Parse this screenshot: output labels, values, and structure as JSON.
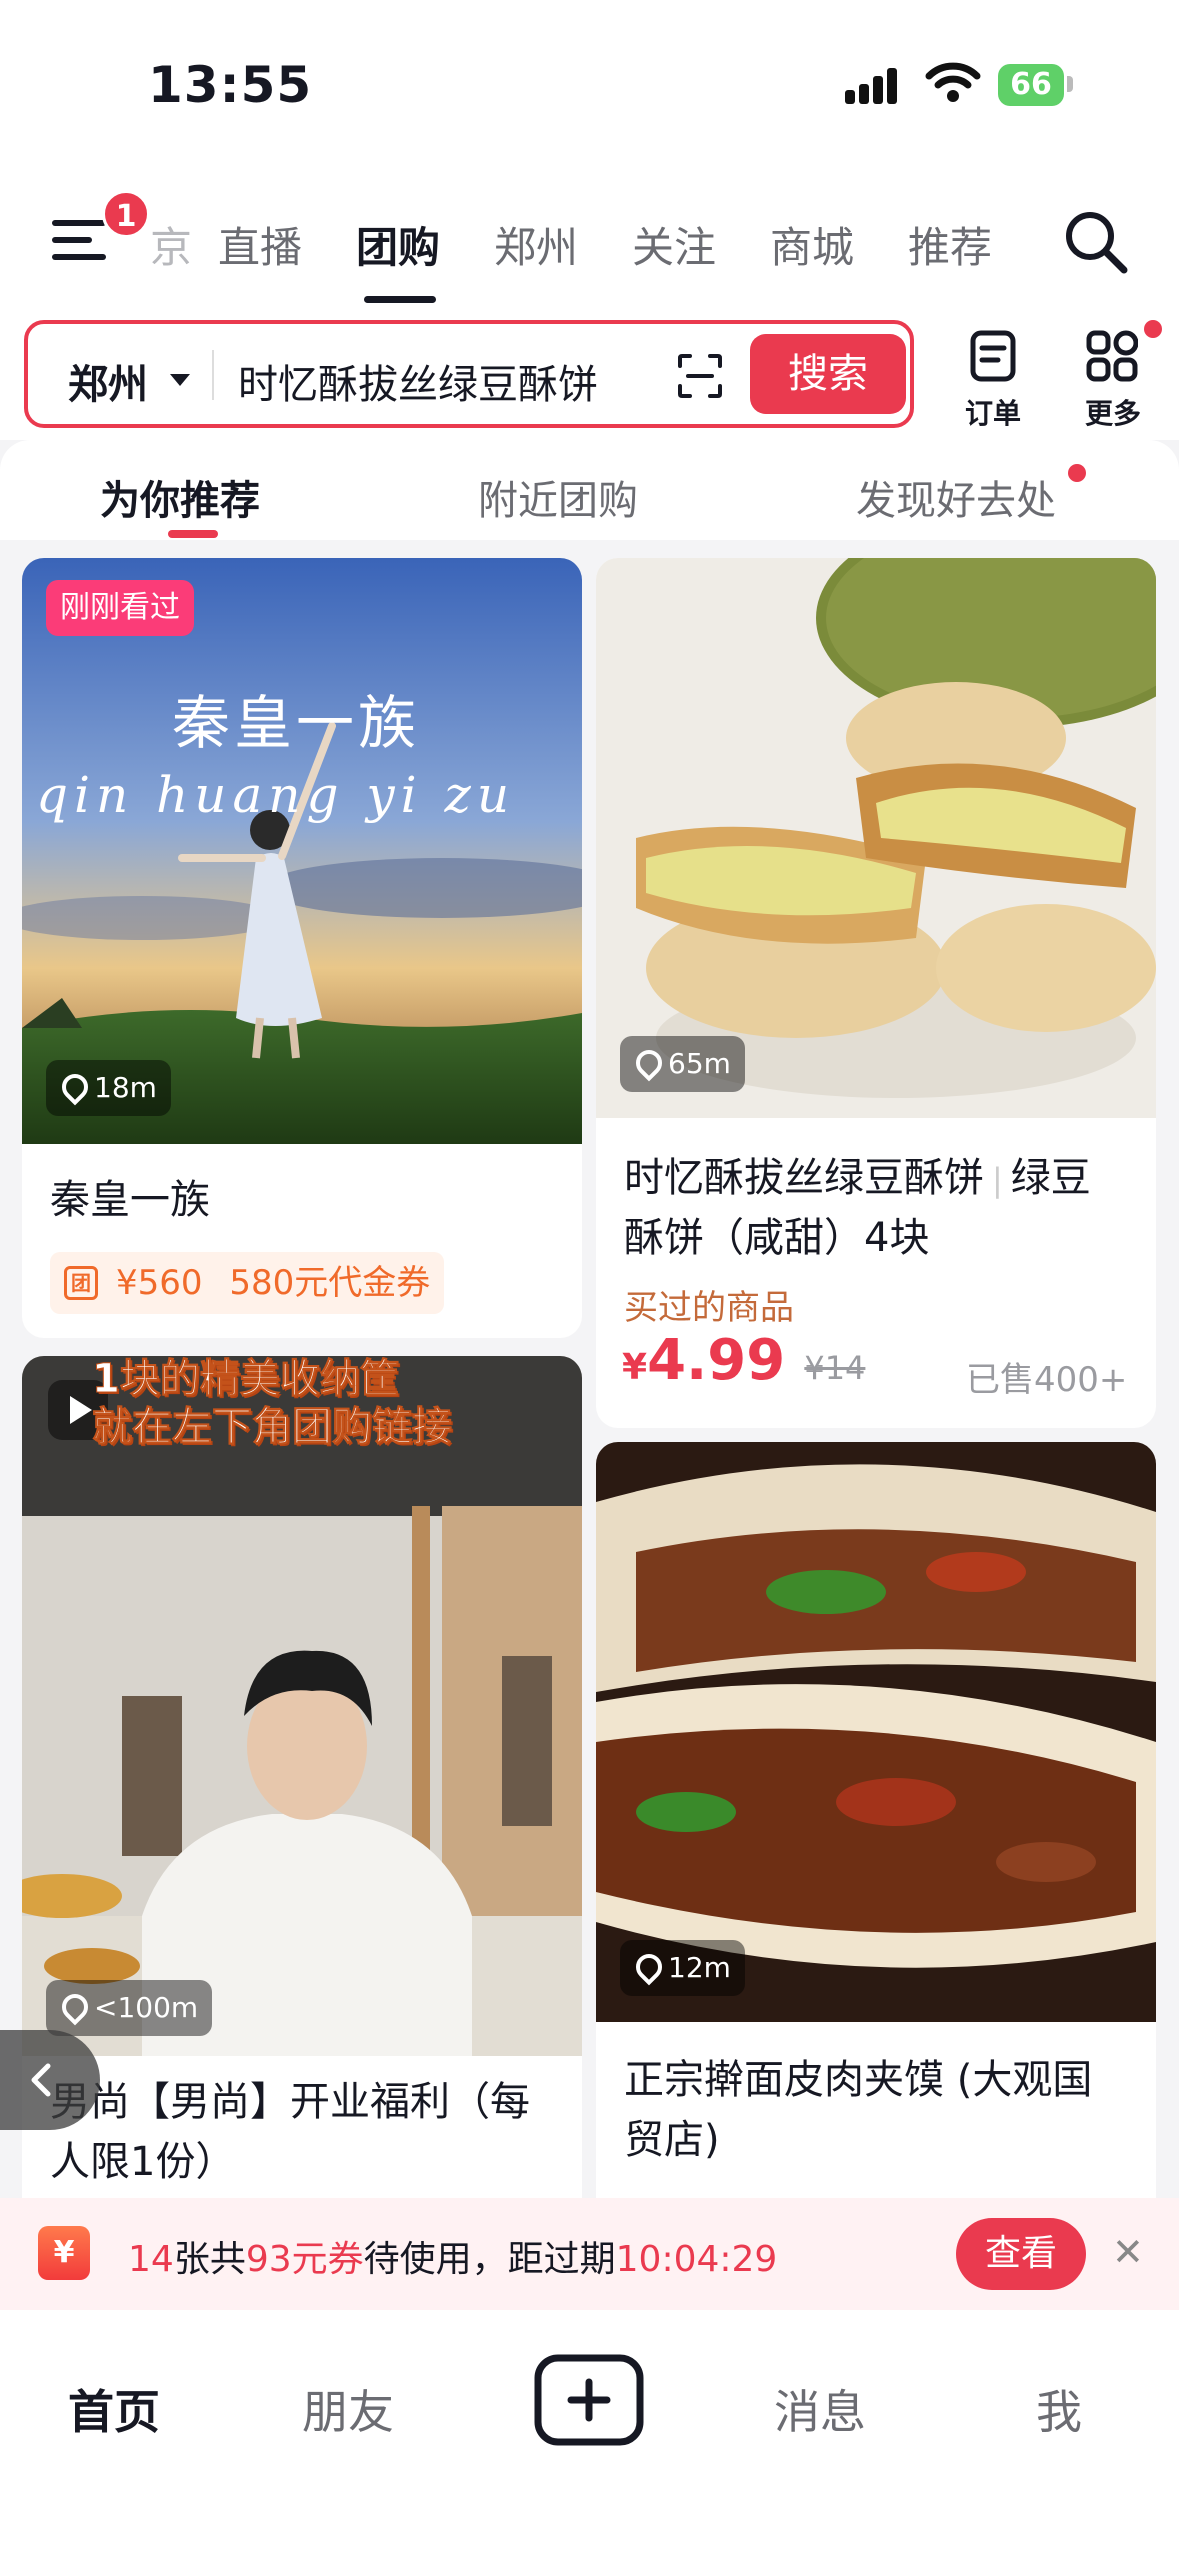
{
  "status_bar": {
    "time": "13:55",
    "battery": "66"
  },
  "top_nav": {
    "badge_count": "1",
    "partial_tab": "京",
    "tabs": [
      "直播",
      "团购",
      "郑州",
      "关注",
      "商城",
      "推荐"
    ],
    "active_tab": "团购"
  },
  "search": {
    "city": "郑州",
    "query": "时忆酥拔丝绿豆酥饼",
    "button_label": "搜索",
    "orders_label": "订单",
    "more_label": "更多"
  },
  "sub_tabs": [
    "为你推荐",
    "附近团购",
    "发现好去处"
  ],
  "cards": [
    {
      "tag": "刚刚看过",
      "overlay_title": "秦皇一族",
      "overlay_pinyin": "qin huang yi zu",
      "distance": "18m",
      "title": "秦皇一族",
      "voucher_icon": "团",
      "voucher_price": "¥560",
      "voucher_text": "580元代金券"
    },
    {
      "distance": "65m",
      "title_line1": "时忆酥拔丝绿豆酥饼",
      "title_line1b": "绿豆",
      "title_line2": "酥饼（咸甜）4块",
      "note": "买过的商品",
      "price_symbol": "¥",
      "price": "4.99",
      "orig_price": "¥14",
      "sold": "已售400+"
    },
    {
      "overlay_line1": "1块的精美收纳筐",
      "overlay_line2": "就在左下角团购链接",
      "distance": "<100m",
      "title_line1": "男尚【男尚】开业福利（每",
      "title_line2": "人限1份）"
    },
    {
      "distance": "12m",
      "title_line1": "正宗擀面皮肉夹馍 (大观国",
      "title_line2": "贸店)"
    }
  ],
  "coupon_bar": {
    "icon": "¥",
    "count": "14",
    "text_a": "张共",
    "amount": "93元券",
    "text_b": "待使用，距过期",
    "countdown": "10:04:29",
    "button_label": "查看"
  },
  "bottom_nav": {
    "items": [
      "首页",
      "朋友",
      "消息",
      "我"
    ],
    "active": "首页"
  },
  "colors": {
    "accent": "#ea3a4f",
    "orange": "#f06a2a",
    "pink_tag": "#fb3c78"
  }
}
